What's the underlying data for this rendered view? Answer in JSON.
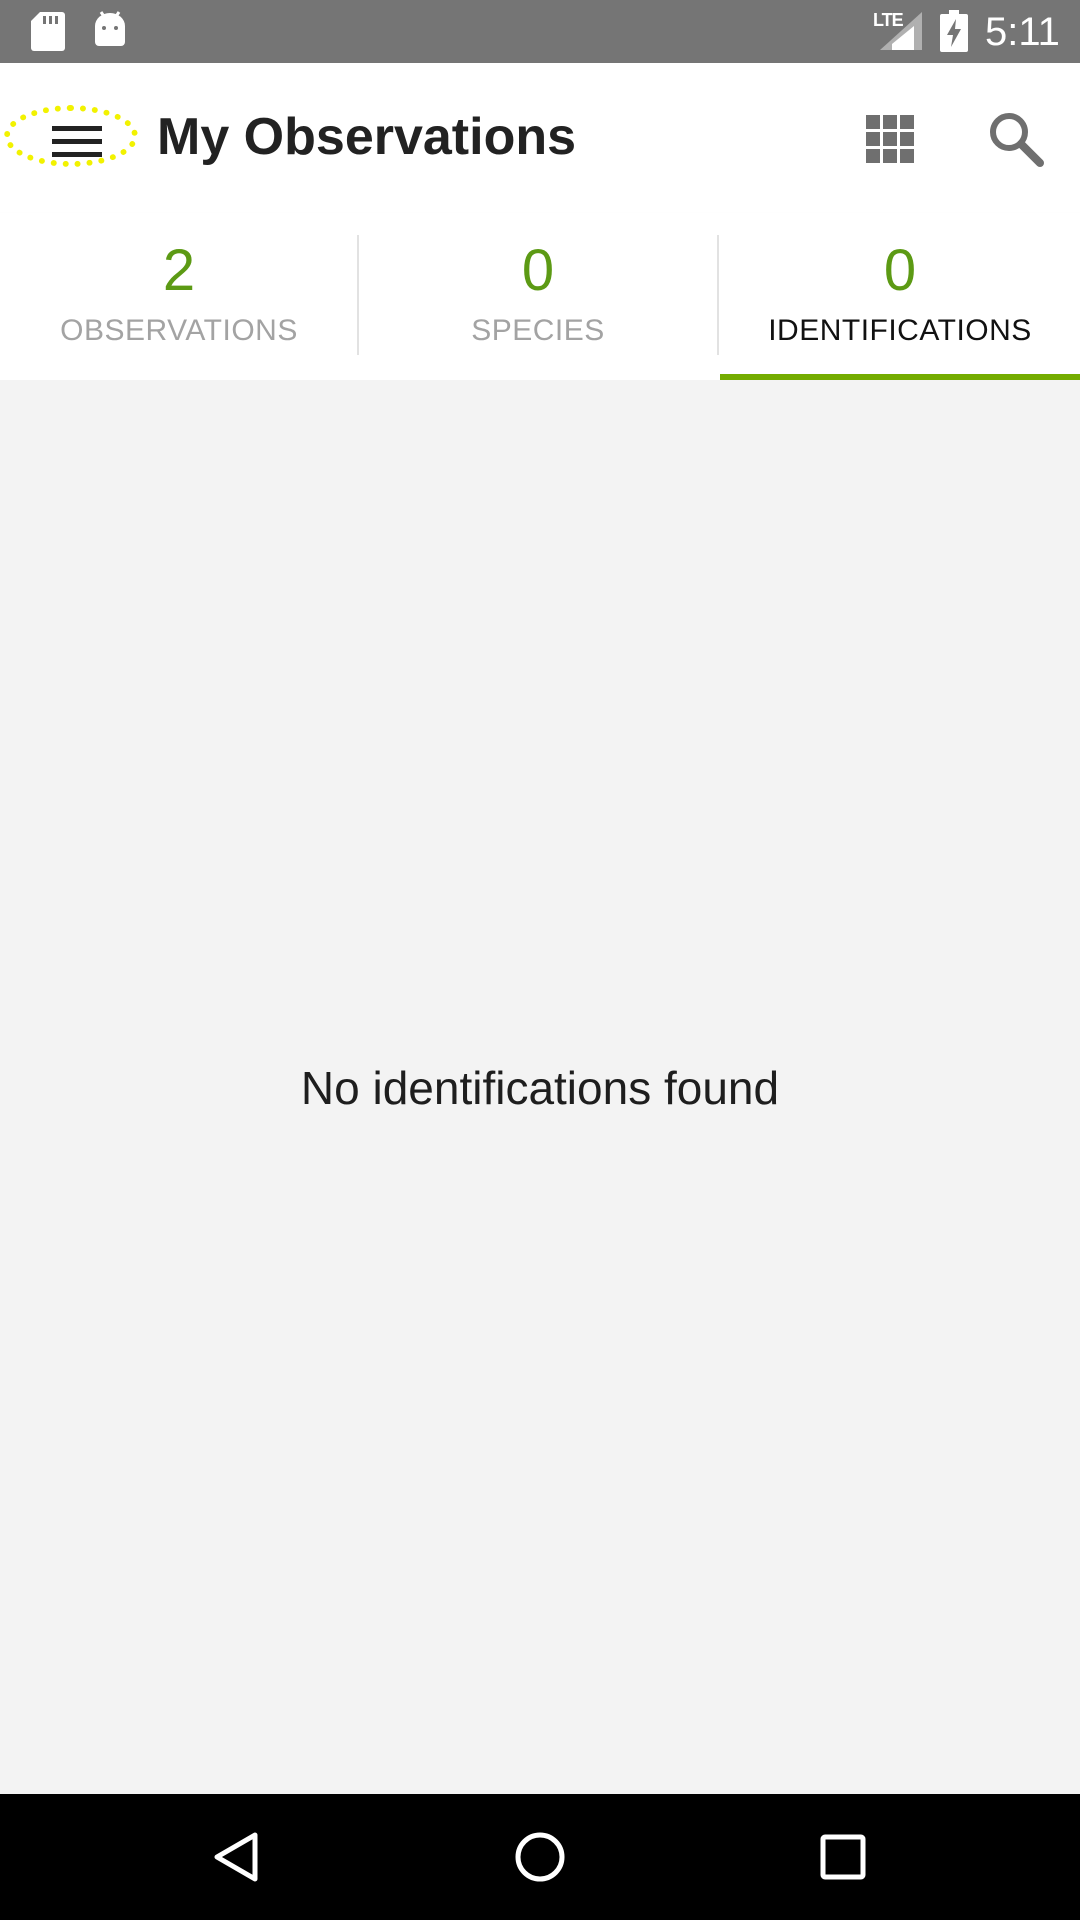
{
  "status_bar": {
    "time": "5:11",
    "network": "LTE",
    "icons": [
      "sd-card-icon",
      "android-debug-icon",
      "signal-icon",
      "battery-charging-icon"
    ]
  },
  "app_bar": {
    "title": "My Observations",
    "menu_icon": "hamburger-menu-icon",
    "actions": [
      "grid-view-icon",
      "search-icon"
    ]
  },
  "tabs": [
    {
      "count": "2",
      "label": "OBSERVATIONS",
      "active": false
    },
    {
      "count": "0",
      "label": "SPECIES",
      "active": false
    },
    {
      "count": "0",
      "label": "IDENTIFICATIONS",
      "active": true
    }
  ],
  "content": {
    "empty_message": "No identifications found"
  },
  "nav_bar": {
    "buttons": [
      "back-icon",
      "home-icon",
      "recents-icon"
    ]
  },
  "colors": {
    "accent_green": "#74ac00",
    "count_green": "#5c9a14",
    "status_bar": "#757575",
    "highlight_yellow": "#f2f200"
  }
}
